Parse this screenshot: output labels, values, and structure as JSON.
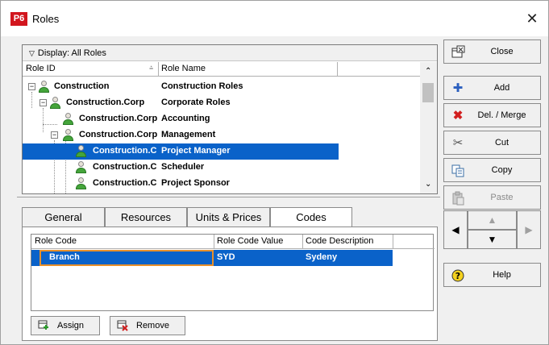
{
  "window": {
    "app_badge": "P6",
    "title": "Roles",
    "close_glyph": "✕"
  },
  "display_bar": {
    "label": "Display: All Roles"
  },
  "grid": {
    "columns": [
      "Role ID",
      "Role Name"
    ],
    "rows": [
      {
        "id": "Construction",
        "name": "Construction Roles",
        "level": 0,
        "toggle": "−"
      },
      {
        "id": "Construction.Corp",
        "name": "Corporate Roles",
        "level": 1,
        "toggle": "−"
      },
      {
        "id": "Construction.Corp",
        "name": "Accounting",
        "level": 2,
        "toggle": ""
      },
      {
        "id": "Construction.Corp",
        "name": "Management",
        "level": 2,
        "toggle": "−"
      },
      {
        "id": "Construction.C",
        "name": "Project Manager",
        "level": 3,
        "toggle": "",
        "selected": true
      },
      {
        "id": "Construction.C",
        "name": "Scheduler",
        "level": 3,
        "toggle": ""
      },
      {
        "id": "Construction.C",
        "name": "Project Sponsor",
        "level": 3,
        "toggle": ""
      }
    ]
  },
  "tabs": [
    {
      "label": "General"
    },
    {
      "label": "Resources"
    },
    {
      "label": "Units & Prices"
    },
    {
      "label": "Codes",
      "active": true
    }
  ],
  "codes": {
    "columns": [
      "Role Code",
      "Role Code Value",
      "Code Description"
    ],
    "rows": [
      {
        "code": "Branch",
        "value": "SYD",
        "description": "Sydeny"
      }
    ]
  },
  "bottom_buttons": {
    "assign": "Assign",
    "remove": "Remove"
  },
  "side_buttons": {
    "close": "Close",
    "add": "Add",
    "del_merge": "Del. / Merge",
    "cut": "Cut",
    "copy": "Copy",
    "paste": "Paste",
    "help": "Help"
  },
  "colors": {
    "selection": "#0a62c9",
    "focus_border": "#e8902a",
    "badge": "#d2161e"
  }
}
